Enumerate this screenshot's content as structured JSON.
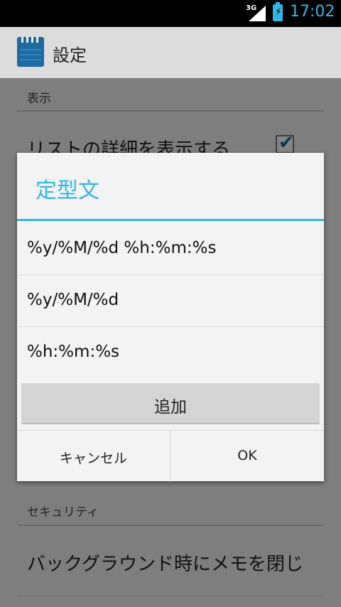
{
  "status_bar": {
    "network": "3G",
    "time": "17:02"
  },
  "action_bar": {
    "title": "設定"
  },
  "background": {
    "section_display": "表示",
    "pref_show_details": "リストの詳細を表示する",
    "pref_show_details_checked": true,
    "section_security": "セキュリティ",
    "pref_close_memo_background": "バックグラウンド時にメモを閉じ"
  },
  "dialog": {
    "title": "定型文",
    "items": [
      "%y/%M/%d %h:%m:%s",
      "%y/%M/%d",
      "%h:%m:%s"
    ],
    "add_label": "追加",
    "cancel_label": "キャンセル",
    "ok_label": "OK"
  },
  "colors": {
    "accent": "#33b5e5",
    "scrim": "#000000"
  }
}
